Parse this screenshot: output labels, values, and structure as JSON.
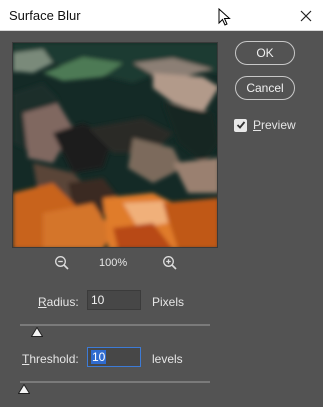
{
  "window": {
    "title": "Surface Blur"
  },
  "buttons": {
    "ok": "OK",
    "cancel": "Cancel"
  },
  "preview_checkbox": {
    "label_first": "P",
    "label_rest": "review",
    "checked": true
  },
  "zoom": {
    "level": "100%"
  },
  "radius": {
    "label_first": "R",
    "label_rest": "adius:",
    "value": "10",
    "unit": "Pixels",
    "slider_fraction": 0.09
  },
  "threshold": {
    "label_first": "T",
    "label_rest": "hreshold:",
    "value": "10",
    "unit": "levels",
    "slider_fraction": 0.02
  },
  "colors": {
    "accent": "#2f6bd0",
    "background": "#535353"
  }
}
